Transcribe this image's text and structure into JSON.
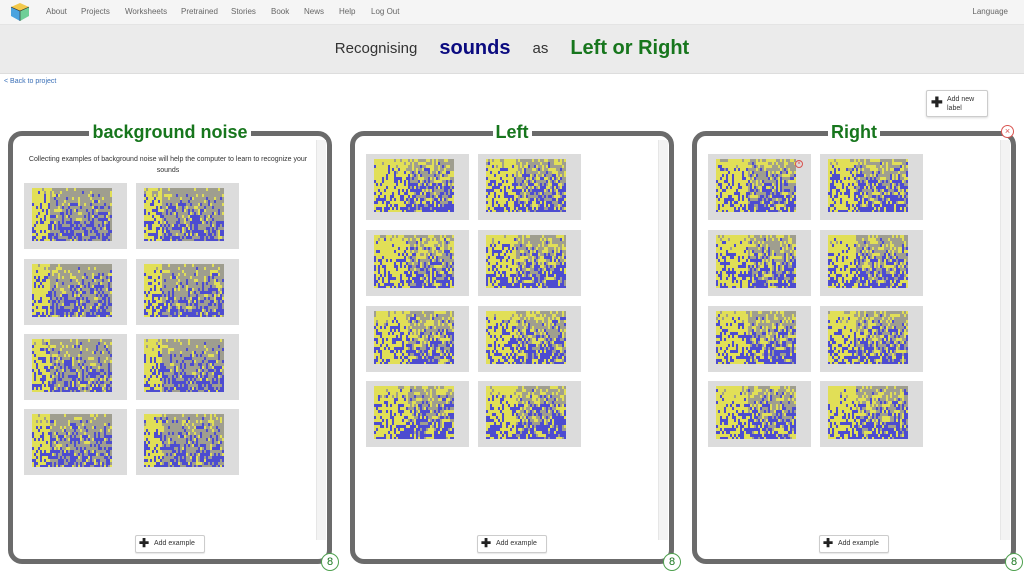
{
  "nav": {
    "items": [
      "About",
      "Projects",
      "Worksheets",
      "Pretrained",
      "Stories",
      "Book",
      "News",
      "Help",
      "Log Out"
    ],
    "language": "Language"
  },
  "heading": {
    "recognising": "Recognising",
    "type": "sounds",
    "as": "as",
    "project": "Left or Right"
  },
  "back_link": "< Back to project",
  "add_label": {
    "line1": "Add new",
    "line2": "label"
  },
  "buckets": [
    {
      "title": "background noise",
      "description": "Collecting examples of background noise will help the computer to learn to recognize your sounds",
      "count": "8",
      "add_example": "Add example"
    },
    {
      "title": "Left",
      "description": "",
      "count": "8",
      "add_example": "Add example"
    },
    {
      "title": "Right",
      "description": "",
      "count": "8",
      "add_example": "Add example"
    }
  ],
  "colors": {
    "title_blue": "#0b0b80",
    "title_green": "#17761d",
    "spectrogram_yellow": "#e8e64a",
    "spectrogram_blue": "#3a3ad8"
  }
}
